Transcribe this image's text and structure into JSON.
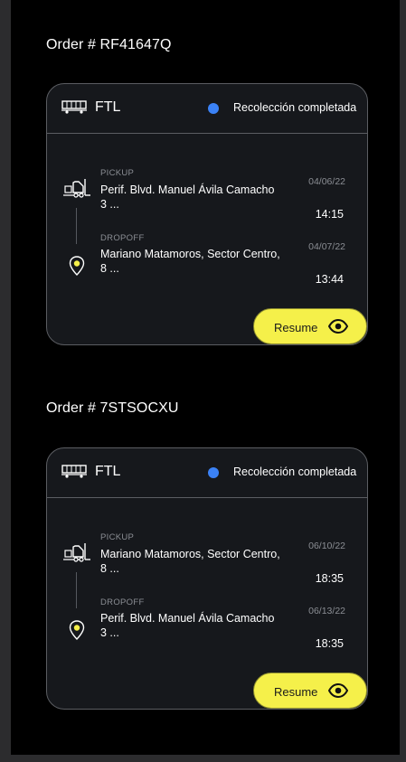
{
  "orders": [
    {
      "title": "Order # RF41647Q",
      "service": "FTL",
      "status": "Recolección completada",
      "pickup": {
        "label": "PICKUP",
        "address": "Perif. Blvd. Manuel Ávila Camacho 3 ...",
        "date": "04/06/22",
        "time": "14:15"
      },
      "dropoff": {
        "label": "DROPOFF",
        "address": "Mariano Matamoros, Sector Centro, 8 ...",
        "date": "04/07/22",
        "time": "13:44"
      },
      "action_label": "Resume"
    },
    {
      "title": "Order # 7STSOCXU",
      "service": "FTL",
      "status": "Recolección completada",
      "pickup": {
        "label": "PICKUP",
        "address": "Mariano Matamoros, Sector Centro, 8 ...",
        "date": "06/10/22",
        "time": "18:35"
      },
      "dropoff": {
        "label": "DROPOFF",
        "address": "Perif. Blvd. Manuel Ávila Camacho 3 ...",
        "date": "06/13/22",
        "time": "18:35"
      },
      "action_label": "Resume"
    }
  ],
  "colors": {
    "background": "#000000",
    "card": "#16181c",
    "status_dot": "#3b82f6",
    "accent_button": "#f5f04a",
    "pin_dot": "#f5f04a"
  },
  "icons": {
    "service": "truck-trailer-icon",
    "pickup": "forklift-icon",
    "dropoff": "map-pin-icon",
    "action": "eye-icon"
  }
}
